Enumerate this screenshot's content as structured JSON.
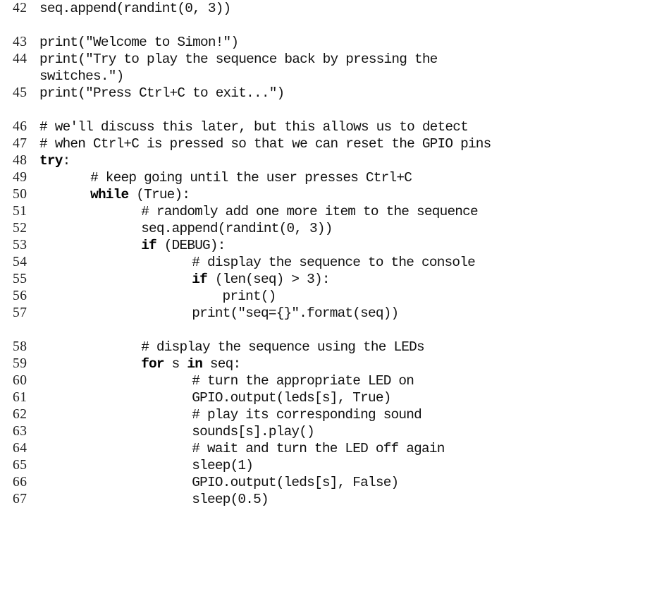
{
  "document": {
    "kind": "python-code-listing",
    "language": "Python",
    "background_color": "#ffffff",
    "text_color": "#111111",
    "keyword_color": "#000000",
    "first_line_number": 42,
    "last_line_number": 67
  },
  "lines": [
    {
      "number": "42",
      "indent": 0,
      "text": "seq.append(randint(0, 3))",
      "tokens": [
        {
          "t": "seq.append(randint(0, 3))",
          "kw": false
        }
      ]
    },
    {
      "number": "",
      "indent": 0,
      "blank": true,
      "text": "",
      "tokens": []
    },
    {
      "number": "43",
      "indent": 0,
      "text": "print(\"Welcome to Simon!\")",
      "tokens": [
        {
          "t": "print(\"Welcome to Simon!\")",
          "kw": false
        }
      ]
    },
    {
      "number": "44",
      "indent": 0,
      "text": "print(\"Try to play the sequence back by pressing the",
      "tokens": [
        {
          "t": "print(\"Try to play the sequence back by pressing the",
          "kw": false
        }
      ]
    },
    {
      "number": "",
      "indent": 0,
      "continuation": true,
      "text": "switches.\")",
      "tokens": [
        {
          "t": "switches.\")",
          "kw": false
        }
      ]
    },
    {
      "number": "45",
      "indent": 0,
      "text": "print(\"Press Ctrl+C to exit...\")",
      "tokens": [
        {
          "t": "print(\"Press Ctrl+C to exit...\")",
          "kw": false
        }
      ]
    },
    {
      "number": "",
      "indent": 0,
      "blank": true,
      "text": "",
      "tokens": []
    },
    {
      "number": "46",
      "indent": 0,
      "text": "# we'll discuss this later, but this allows us to detect",
      "tokens": [
        {
          "t": "# we'll discuss this later, but this allows us to detect",
          "kw": false
        }
      ]
    },
    {
      "number": "47",
      "indent": 0,
      "text": "# when Ctrl+C is pressed so that we can reset the GPIO pins",
      "tokens": [
        {
          "t": "# when Ctrl+C is pressed so that we can reset the GPIO pins",
          "kw": false
        }
      ]
    },
    {
      "number": "48",
      "indent": 0,
      "text": "try:",
      "tokens": [
        {
          "t": "try",
          "kw": true
        },
        {
          "t": ":",
          "kw": false
        }
      ]
    },
    {
      "number": "49",
      "indent": 5,
      "text": "# keep going until the user presses Ctrl+C",
      "tokens": [
        {
          "t": "# keep going until the user presses Ctrl+C",
          "kw": false
        }
      ]
    },
    {
      "number": "50",
      "indent": 5,
      "text": "while (True):",
      "tokens": [
        {
          "t": "while",
          "kw": true
        },
        {
          "t": " (True):",
          "kw": false
        }
      ]
    },
    {
      "number": "51",
      "indent": 10,
      "text": "# randomly add one more item to the sequence",
      "tokens": [
        {
          "t": "# randomly add one more item to the sequence",
          "kw": false
        }
      ]
    },
    {
      "number": "52",
      "indent": 10,
      "text": "seq.append(randint(0, 3))",
      "tokens": [
        {
          "t": "seq.append(randint(0, 3))",
          "kw": false
        }
      ]
    },
    {
      "number": "53",
      "indent": 10,
      "text": "if (DEBUG):",
      "tokens": [
        {
          "t": "if",
          "kw": true
        },
        {
          "t": " (DEBUG):",
          "kw": false
        }
      ]
    },
    {
      "number": "54",
      "indent": 15,
      "text": "# display the sequence to the console",
      "tokens": [
        {
          "t": "# display the sequence to the console",
          "kw": false
        }
      ]
    },
    {
      "number": "55",
      "indent": 15,
      "text": "if (len(seq) > 3):",
      "tokens": [
        {
          "t": "if",
          "kw": true
        },
        {
          "t": " (len(seq) > 3):",
          "kw": false
        }
      ]
    },
    {
      "number": "56",
      "indent": 18,
      "text": "print()",
      "tokens": [
        {
          "t": "print()",
          "kw": false
        }
      ]
    },
    {
      "number": "57",
      "indent": 15,
      "text": "print(\"seq={}\".format(seq))",
      "tokens": [
        {
          "t": "print(\"seq={}\".format(seq))",
          "kw": false
        }
      ]
    },
    {
      "number": "",
      "indent": 0,
      "blank": true,
      "text": "",
      "tokens": []
    },
    {
      "number": "58",
      "indent": 10,
      "text": "# display the sequence using the LEDs",
      "tokens": [
        {
          "t": "# display the sequence using the LEDs",
          "kw": false
        }
      ]
    },
    {
      "number": "59",
      "indent": 10,
      "text": "for s in seq:",
      "tokens": [
        {
          "t": "for",
          "kw": true
        },
        {
          "t": " s ",
          "kw": false
        },
        {
          "t": "in",
          "kw": true
        },
        {
          "t": " seq:",
          "kw": false
        }
      ]
    },
    {
      "number": "60",
      "indent": 15,
      "text": "# turn the appropriate LED on",
      "tokens": [
        {
          "t": "# turn the appropriate LED on",
          "kw": false
        }
      ]
    },
    {
      "number": "61",
      "indent": 15,
      "text": "GPIO.output(leds[s], True)",
      "tokens": [
        {
          "t": "GPIO.output(leds[s], True)",
          "kw": false
        }
      ]
    },
    {
      "number": "62",
      "indent": 15,
      "text": "# play its corresponding sound",
      "tokens": [
        {
          "t": "# play its corresponding sound",
          "kw": false
        }
      ]
    },
    {
      "number": "63",
      "indent": 15,
      "text": "sounds[s].play()",
      "tokens": [
        {
          "t": "sounds[s].play()",
          "kw": false
        }
      ]
    },
    {
      "number": "64",
      "indent": 15,
      "text": "# wait and turn the LED off again",
      "tokens": [
        {
          "t": "# wait and turn the LED off again",
          "kw": false
        }
      ]
    },
    {
      "number": "65",
      "indent": 15,
      "text": "sleep(1)",
      "tokens": [
        {
          "t": "sleep(1)",
          "kw": false
        }
      ]
    },
    {
      "number": "66",
      "indent": 15,
      "text": "GPIO.output(leds[s], False)",
      "tokens": [
        {
          "t": "GPIO.output(leds[s], False)",
          "kw": false
        }
      ]
    },
    {
      "number": "67",
      "indent": 15,
      "text": "sleep(0.5)",
      "tokens": [
        {
          "t": "sleep(0.5)",
          "kw": false
        }
      ]
    }
  ]
}
